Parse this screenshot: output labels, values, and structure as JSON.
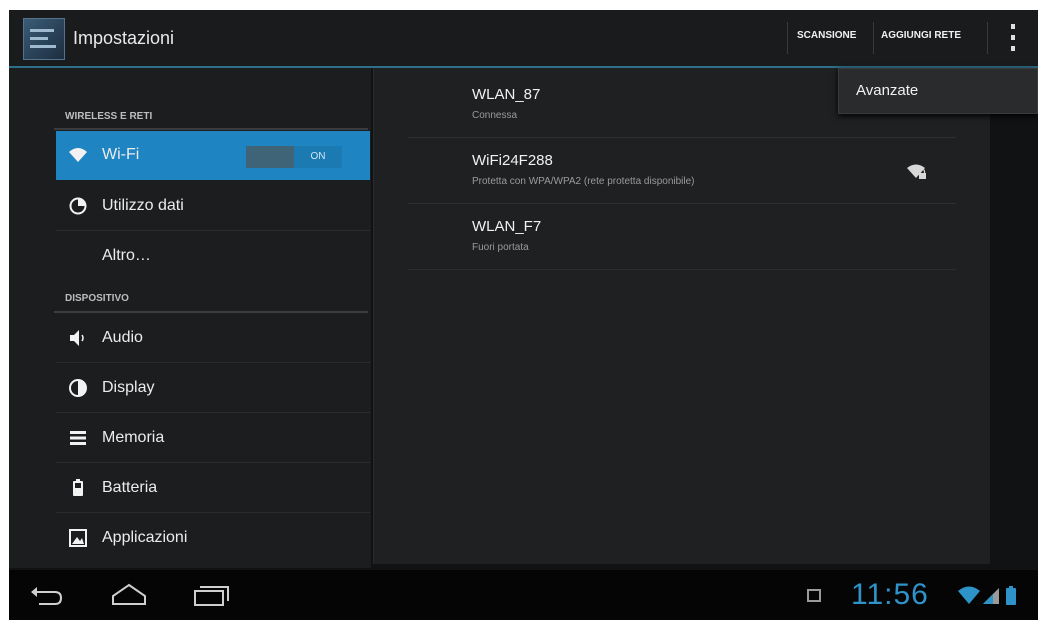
{
  "action_bar": {
    "title": "Impostazioni",
    "scan_label": "SCANSIONE",
    "add_network_label": "AGGIUNGI RETE",
    "overflow_icon": "overflow-menu-icon",
    "app_icon": "settings-app-icon"
  },
  "sidebar": {
    "sections": [
      {
        "header": "WIRELESS E RETI"
      },
      {
        "header": "DISPOSITIVO"
      }
    ],
    "items": [
      {
        "label": "Wi-Fi",
        "icon": "wifi-icon",
        "selected": true
      },
      {
        "label": "Utilizzo dati",
        "icon": "data-usage-icon"
      },
      {
        "label": "Altro…",
        "icon": ""
      },
      {
        "label": "Audio",
        "icon": "speaker-icon"
      },
      {
        "label": "Display",
        "icon": "display-icon"
      },
      {
        "label": "Memoria",
        "icon": "storage-icon"
      },
      {
        "label": "Batteria",
        "icon": "battery-icon"
      },
      {
        "label": "Applicazioni",
        "icon": "apps-icon"
      }
    ],
    "wifi_toggle": {
      "state_label": "ON"
    }
  },
  "networks": [
    {
      "ssid": "WLAN_87",
      "status": "Connessa"
    },
    {
      "ssid": "WiFi24F288",
      "status": "Protetta con WPA/WPA2 (rete protetta disponibile)",
      "icon": "wifi-lock-icon"
    },
    {
      "ssid": "WLAN_F7",
      "status": "Fuori portata"
    }
  ],
  "overflow_menu": {
    "items": [
      "Avanzate"
    ]
  },
  "system_bar": {
    "clock": "11:56",
    "nav_icons": [
      "back-icon",
      "home-icon",
      "recent-apps-icon"
    ],
    "status_icons": [
      "wifi-signal-icon",
      "cell-signal-icon",
      "battery-status-icon"
    ],
    "accent_color": "#2e93c9"
  }
}
